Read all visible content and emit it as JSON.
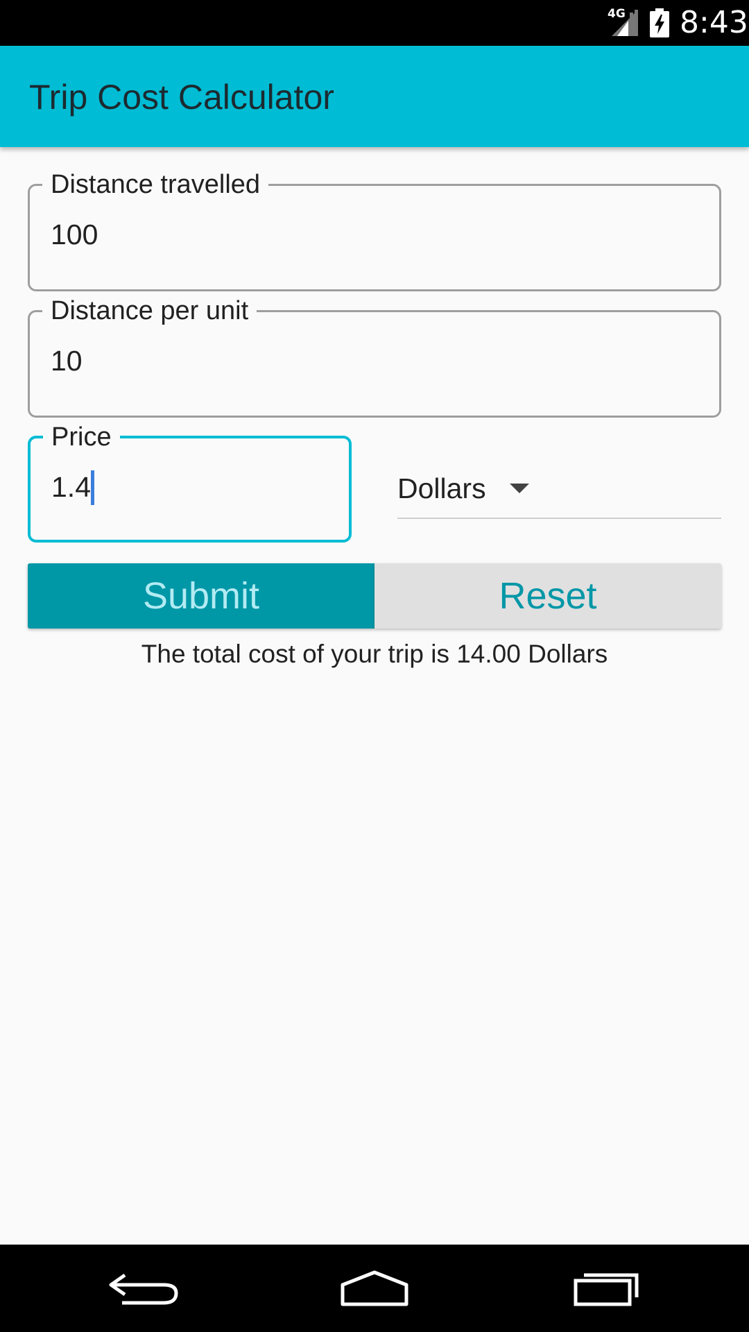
{
  "status_bar": {
    "network": "4G",
    "time": "8:43"
  },
  "app_bar": {
    "title": "Trip Cost Calculator"
  },
  "form": {
    "distance_travelled": {
      "label": "Distance travelled",
      "value": "100"
    },
    "distance_per_unit": {
      "label": "Distance per unit",
      "value": "10"
    },
    "price": {
      "label": "Price",
      "value": "1.4"
    },
    "currency": {
      "selected": "Dollars"
    }
  },
  "buttons": {
    "submit": "Submit",
    "reset": "Reset"
  },
  "result_text": "The total cost of your trip is 14.00 Dollars",
  "colors": {
    "primary": "#00bcd4",
    "primary_dark": "#0097a7",
    "submit_text": "#b2ebf2",
    "reset_bg": "#e0e0e0",
    "caret": "#3b7ddd"
  },
  "icons": {
    "signal": "signal-icon",
    "battery": "battery-charging-icon",
    "back": "back-icon",
    "home": "home-icon",
    "recents": "recents-icon",
    "dropdown": "dropdown-arrow-icon"
  }
}
